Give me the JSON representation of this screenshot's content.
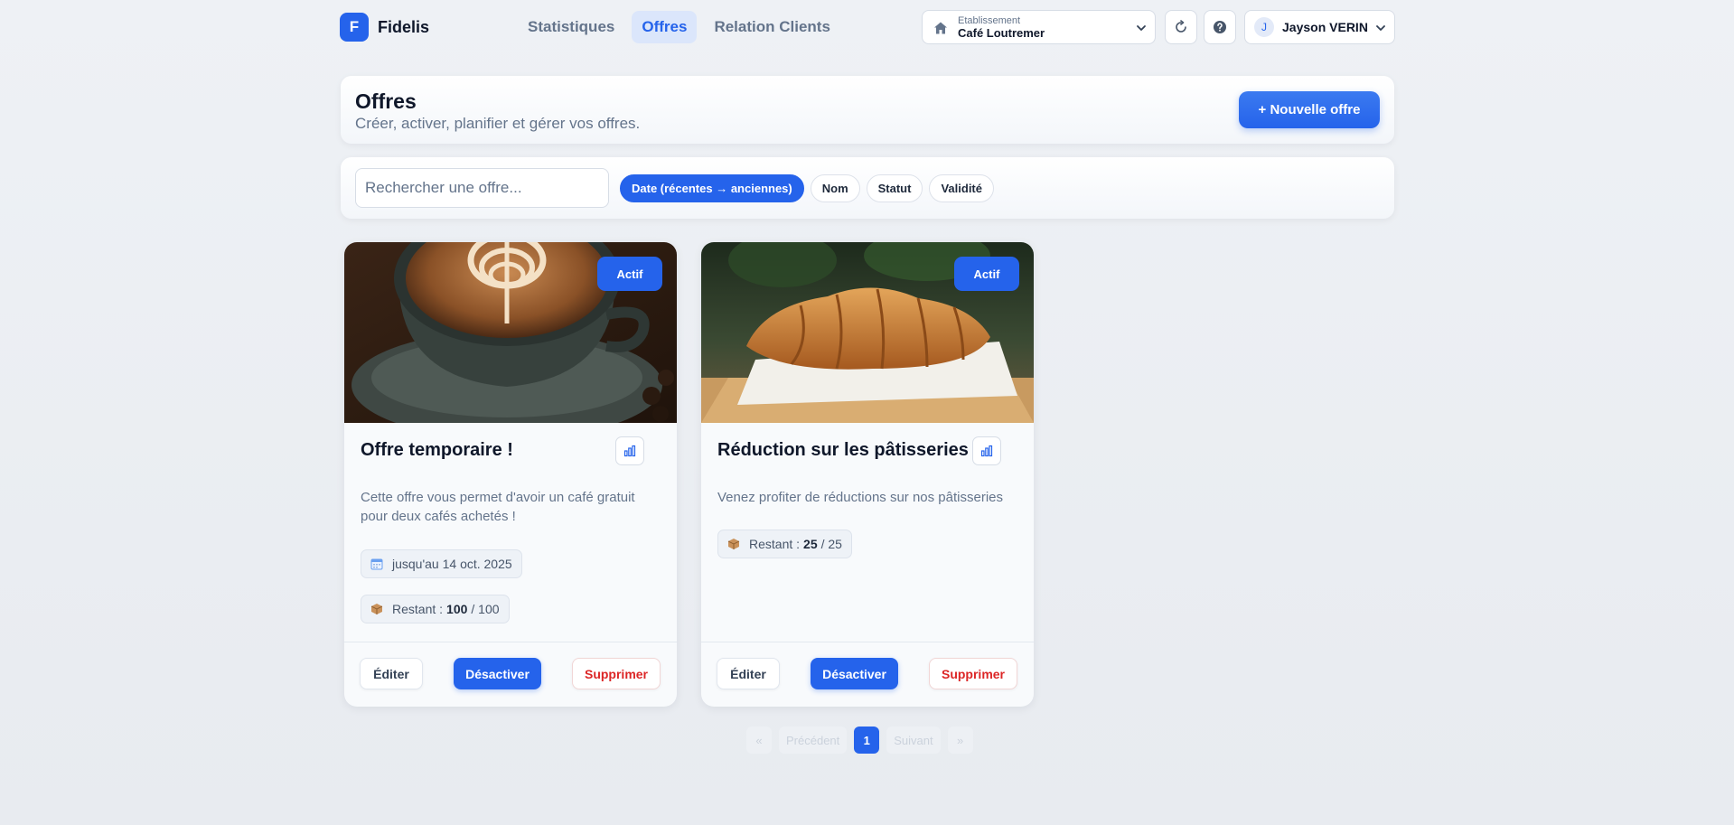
{
  "brand": {
    "logo_letter": "F",
    "name": "Fidelis"
  },
  "nav": {
    "items": [
      {
        "label": "Statistiques"
      },
      {
        "label": "Offres"
      },
      {
        "label": "Relation Clients"
      }
    ]
  },
  "establishment": {
    "label": "Etablissement",
    "value": "Café Loutremer"
  },
  "user": {
    "initial": "J",
    "name": "Jayson VERIN"
  },
  "header": {
    "title": "Offres",
    "subtitle": "Créer, activer, planifier et gérer vos offres.",
    "new_button": "+ Nouvelle offre"
  },
  "filters": {
    "search_placeholder": "Rechercher une offre...",
    "sort_options": [
      {
        "label": "Date (récentes → anciennes)",
        "active": true
      },
      {
        "label": "Nom"
      },
      {
        "label": "Statut"
      },
      {
        "label": "Validité"
      }
    ]
  },
  "offers": [
    {
      "status": "Actif",
      "title": "Offre temporaire !",
      "description": "Cette offre vous permet d'avoir un café gratuit pour deux cafés achetés !",
      "validity": "jusqu'au 14 oct. 2025",
      "remaining_label": "Restant :",
      "remaining": "100",
      "total": "/ 100"
    },
    {
      "status": "Actif",
      "title": "Réduction sur les pâtisseries",
      "description": "Venez profiter de réductions sur nos pâtisseries",
      "remaining_label": "Restant :",
      "remaining": "25",
      "total": "/ 25"
    }
  ],
  "card_actions": {
    "edit": "Éditer",
    "deactivate": "Désactiver",
    "delete": "Supprimer"
  },
  "pagination": {
    "first": "«",
    "prev": "Précédent",
    "current": "1",
    "next": "Suivant",
    "last": "»"
  },
  "colors": {
    "accent": "#2563eb",
    "danger": "#dc2626",
    "muted": "#64748b"
  }
}
